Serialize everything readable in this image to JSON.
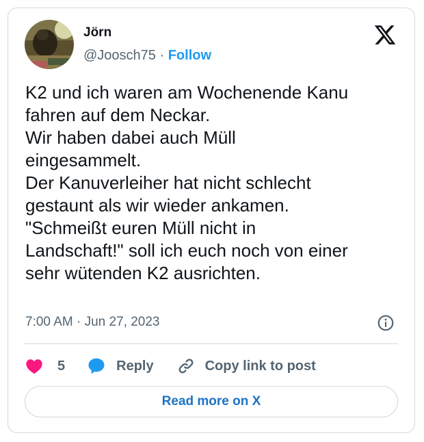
{
  "author": {
    "name": "Jörn",
    "handle": "@Joosch75",
    "separator": "·",
    "follow_label": "Follow"
  },
  "post": {
    "text": "K2 und ich waren am Wochenende Kanu\nfahren auf dem Neckar.\nWir haben dabei auch Müll\neingesammelt.\nDer Kanuverleiher hat nicht schlecht\ngestaunt als wir wieder ankamen.\n\"Schmeißt euren Müll nicht in\nLandschaft!\" soll ich euch noch von einer\nsehr wütenden K2 ausrichten.",
    "time": "7:00 AM",
    "separator": "·",
    "date": "Jun 27, 2023"
  },
  "actions": {
    "like_count": "5",
    "reply_label": "Reply",
    "copy_link_label": "Copy link to post"
  },
  "read_more_label": "Read more on X",
  "icons": {
    "brand": "x-logo-icon",
    "like": "heart-icon",
    "reply": "speech-bubble-icon",
    "copy": "link-icon",
    "info": "info-icon"
  },
  "colors": {
    "like": "#f91880",
    "reply": "#1d9bf0",
    "link": "#1d9bf0",
    "text_secondary": "#536471",
    "border": "#cfd9de"
  }
}
